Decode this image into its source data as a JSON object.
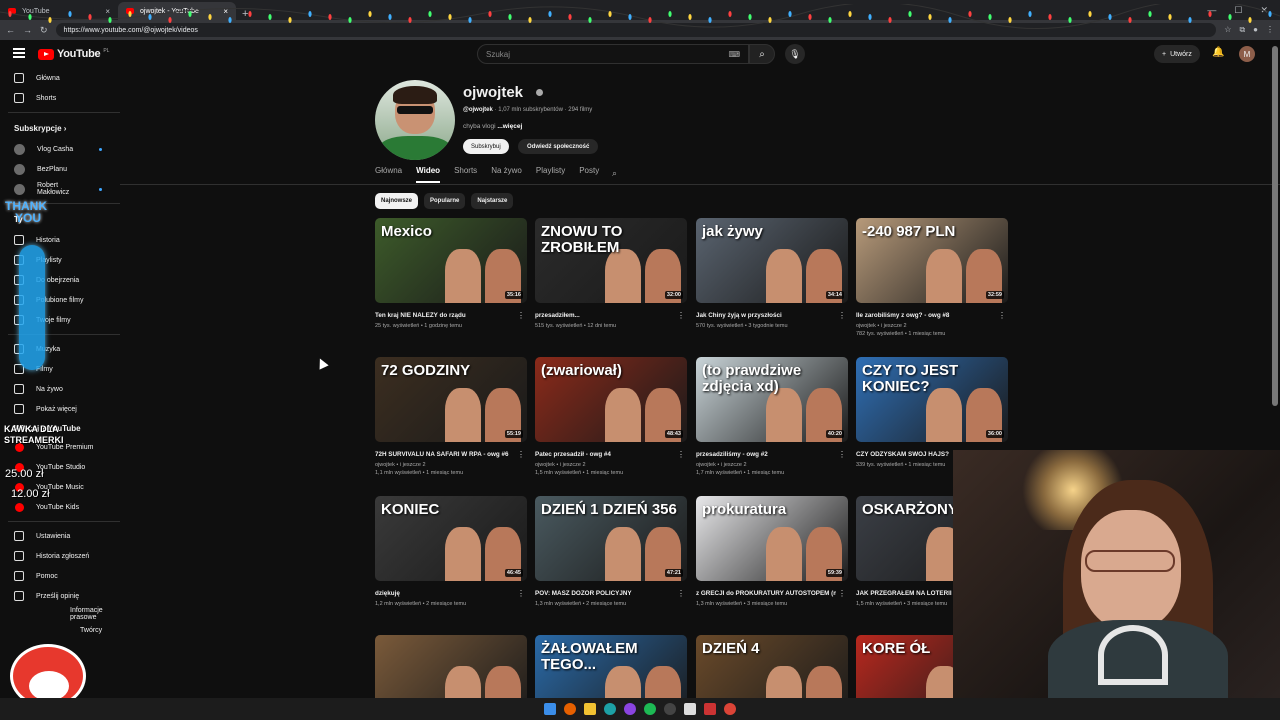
{
  "browser": {
    "tabs": [
      {
        "label": "YouTube",
        "active": false
      },
      {
        "label": "ojwojtek - YouTube",
        "active": true
      }
    ],
    "url": "https://www.youtube.com/@ojwojtek/videos"
  },
  "header": {
    "logo": "YouTube",
    "logo_country": "PL",
    "search_placeholder": "Szukaj",
    "create_label": "Utwórz",
    "avatar_letter": "M"
  },
  "sidebar": {
    "home": "Główna",
    "shorts": "Shorts",
    "subscriptions_title": "Subskrypcje",
    "subscriptions": [
      "Vlog Casha",
      "BezPlanu",
      "Robert Makłowicz"
    ],
    "you_title": "Ty",
    "you_items": [
      "Historia",
      "Playlisty",
      "Do obejrzenia",
      "Polubione filmy",
      "Twoje filmy"
    ],
    "explore_items": [
      "Muzyka",
      "Filmy",
      "Na żywo"
    ],
    "show_more": "Pokaż więcej",
    "more_title": "Więcej z YouTube",
    "more_items": [
      "YouTube Premium",
      "YouTube Studio",
      "YouTube Music",
      "YouTube Kids"
    ],
    "settings_items": [
      "Ustawienia",
      "Historia zgłoszeń",
      "Pomoc",
      "Prześlij opinię"
    ],
    "footer_items": [
      "Informacje prasowe",
      "Twórcy"
    ]
  },
  "overlay": {
    "thank": "THANK",
    "you": "YOU",
    "kawka": "KAWKA DLA",
    "streamerki": "STREAMERKI",
    "price1": "25.00 zł",
    "price2": "12.00 zł"
  },
  "channel": {
    "name": "ojwojtek",
    "handle": "@ojwojtek",
    "subs": "· 1,07 mln subskrybentów · 294 filmy",
    "desc": "chyba vlogi ",
    "desc_more": "...więcej",
    "subscribe": "Subskrybuj",
    "community": "Odwiedź społeczność"
  },
  "channel_tabs": [
    "Główna",
    "Wideo",
    "Shorts",
    "Na żywo",
    "Playlisty",
    "Posty"
  ],
  "chips": [
    "Najnowsze",
    "Popularne",
    "Najstarsze"
  ],
  "videos": [
    {
      "title": "Ten kraj NIE NALEŻY do rządu",
      "meta": "25 tys. wyświetleń • 1 godzinę temu",
      "duration": "35:16",
      "thumb_text": "Mexico",
      "bg": "#3d5b2a"
    },
    {
      "title": "przesadziłem...",
      "meta": "515 tys. wyświetleń • 12 dni temu",
      "duration": "32:00",
      "thumb_text": "ZNOWU TO ZROBIŁEM",
      "bg": "#2b2b2b"
    },
    {
      "title": "Jak Chiny żyją w przyszłości",
      "meta": "570 tys. wyświetleń • 3 tygodnie temu",
      "duration": "34:14",
      "thumb_text": "jak żywy",
      "bg": "#5a6470"
    },
    {
      "title": "Ile zarobiliśmy z owg? - owg #8",
      "meta": "ojwojtek • i jeszcze 2",
      "meta2": "782 tys. wyświetleń • 1 miesiąc temu",
      "duration": "32:59",
      "thumb_text": "-240 987 PLN",
      "bg": "#b79a7a"
    },
    {
      "title": "72H SURVIVALU NA SAFARI W RPA - owg #6",
      "meta": "ojwojtek • i jeszcze 2",
      "meta2": "1,1 mln wyświetleń • 1 miesiąc temu",
      "duration": "55:19",
      "thumb_text": "72 GODZINY",
      "bg": "#3c2e20"
    },
    {
      "title": "Patec przesadził - owg #4",
      "meta": "ojwojtek • i jeszcze 2",
      "meta2": "1,5 mln wyświetleń • 1 miesiąc temu",
      "duration": "48:43",
      "thumb_text": "(zwariował)",
      "bg": "#8b2a1a"
    },
    {
      "title": "przesadziliśmy - owg #2",
      "meta": "ojwojtek • i jeszcze 2",
      "meta2": "1,7 mln wyświetleń • 1 miesiąc temu",
      "duration": "40:20",
      "thumb_text": "(to prawdziwe zdjęcia xd)",
      "bg": "#c9d4d8"
    },
    {
      "title": "CZY ODZYSKAM SWÓJ HAJS?",
      "meta": "339 tys. wyświetleń • 1 miesiąc temu",
      "duration": "36:00",
      "thumb_text": "CZY TO JEST KONIEC?",
      "bg": "#2f6fb5"
    },
    {
      "title": "dziękuję",
      "meta": "1,2 mln wyświetleń • 2 miesiące temu",
      "duration": "46:45",
      "thumb_text": "KONIEC",
      "bg": "#3a3a3a"
    },
    {
      "title": "POV: MASZ DOZÓR POLICYJNY",
      "meta": "1,3 mln wyświetleń • 2 miesiące temu",
      "duration": "47:21",
      "thumb_text": "DZIEŃ 1     DZIEŃ 356",
      "bg": "#4a5a60"
    },
    {
      "title": "z GRECJI do PROKURATURY AUTOSTOPEM (na przesłuchanie)",
      "meta": "1,3 mln wyświetleń • 3 miesiące temu",
      "duration": "59:39",
      "thumb_text": "prokuratura",
      "bg": "#e8e8ea"
    },
    {
      "title": "JAK PRZEGRAŁEM NA LOTERII",
      "meta": "1,5 mln wyświetleń • 3 miesiące temu",
      "duration": "",
      "thumb_text": "OSKARŻONY",
      "bg": "#3b3f46"
    },
    {
      "title": "",
      "meta": "",
      "duration": "",
      "thumb_text": "",
      "bg": "#7a5a3a"
    },
    {
      "title": "",
      "meta": "",
      "duration": "",
      "thumb_text": "ŻAŁOWAŁEM TEGO...",
      "bg": "#2a6aa8"
    },
    {
      "title": "",
      "meta": "",
      "duration": "",
      "thumb_text": "DZIEŃ 4",
      "bg": "#6a4a2a"
    },
    {
      "title": "",
      "meta": "",
      "duration": "",
      "thumb_text": "KORE ÓŁ",
      "bg": "#b8281e"
    }
  ]
}
